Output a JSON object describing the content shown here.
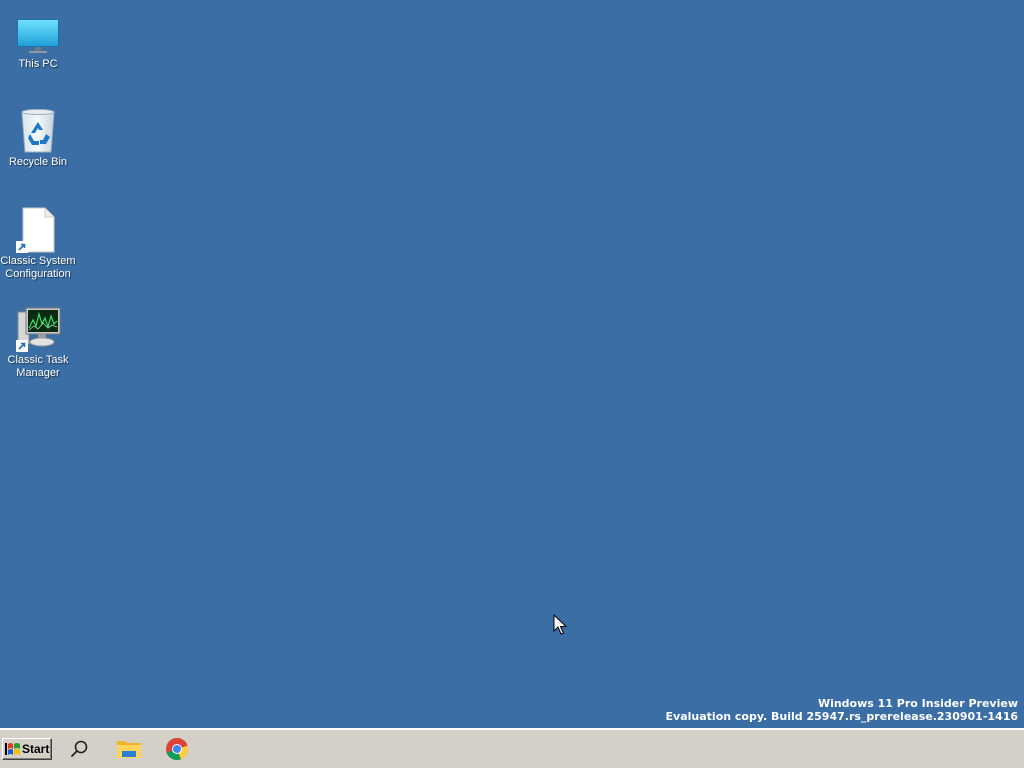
{
  "desktop": {
    "background_color": "#3a6ea5",
    "icons": [
      {
        "label": "This PC",
        "icon": "monitor-icon"
      },
      {
        "label": "Recycle Bin",
        "icon": "recycle-bin-icon"
      },
      {
        "label": "Classic System Configuration",
        "icon": "document-icon",
        "shortcut": true
      },
      {
        "label": "Classic Task Manager",
        "icon": "task-manager-icon",
        "shortcut": true
      }
    ]
  },
  "watermark": {
    "line1": "Windows 11 Pro Insider Preview",
    "line2": "Evaluation copy. Build 25947.rs_prerelease.230901-1416"
  },
  "taskbar": {
    "background_color": "#d4d0c8",
    "start_label": "Start",
    "pinned": [
      {
        "icon": "search-icon"
      },
      {
        "icon": "file-explorer-icon"
      },
      {
        "icon": "chrome-icon"
      }
    ]
  }
}
